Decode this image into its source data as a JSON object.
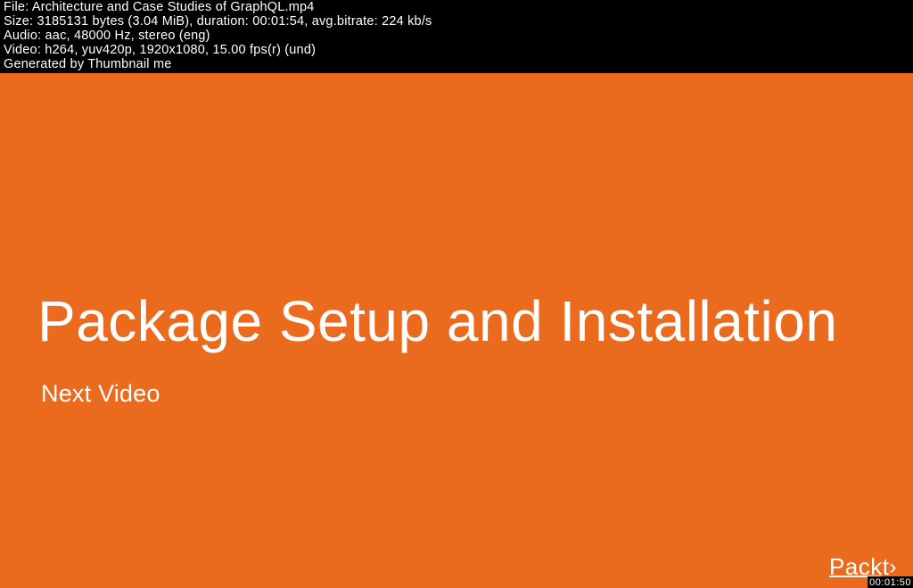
{
  "header": {
    "line1_label": "File: ",
    "line1_value": "Architecture and Case Studies of GraphQL.mp4",
    "line2": "Size: 3185131 bytes (3.04 MiB), duration: 00:01:54, avg.bitrate: 224 kb/s",
    "line3": "Audio: aac, 48000 Hz, stereo (eng)",
    "line4": "Video: h264, yuv420p, 1920x1080, 15.00 fps(r) (und)",
    "line5": "Generated by Thumbnail me"
  },
  "slide": {
    "title": "Package Setup and Installation",
    "subtitle": "Next Video",
    "brand": "Packt",
    "brand_brace": "›"
  },
  "timestamp": "00:01:50"
}
